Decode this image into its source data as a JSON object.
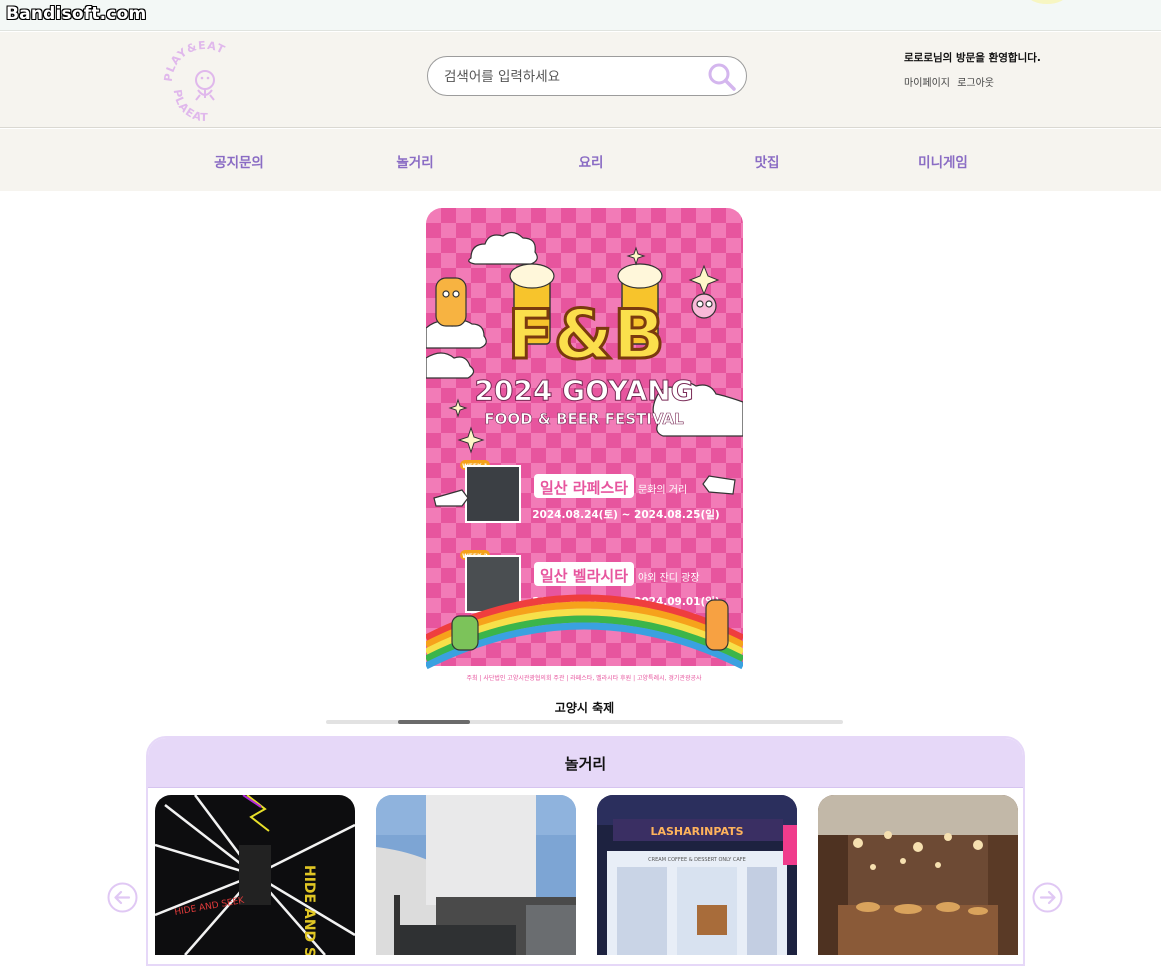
{
  "watermark": {
    "text": "Bandisoft.com"
  },
  "header": {
    "logo_text_top": "PLAY&EAT",
    "logo_text_bottom": "PLAEAT",
    "search": {
      "placeholder": "검색어를 입력하세요",
      "value": ""
    },
    "greeting": "로로로님의 방문을 환영합니다.",
    "links": {
      "mypage": "마이페이지",
      "logout": "로그아웃"
    }
  },
  "nav": {
    "items": [
      {
        "label": "공지문의"
      },
      {
        "label": "놀거리"
      },
      {
        "label": "요리"
      },
      {
        "label": "맛집"
      },
      {
        "label": "미니게임"
      }
    ]
  },
  "banner": {
    "poster": {
      "logo": "F&B",
      "title": "2024 GOYANG",
      "subtitle": "FOOD & BEER FESTIVAL",
      "week1_badge": "WEEK 1",
      "week1_place": "일산 라페스타",
      "week1_place_sub": "문화의 거리",
      "week1_date": "2024.08.24(토) ~ 2024.08.25(일)",
      "week2_badge": "WEEK 2",
      "week2_place": "일산 벨라시타",
      "week2_place_sub": "야외 잔디 광장",
      "week2_date": "2024.08.31(토) ~ 2024.09.01(일)",
      "footer": "주최 | 사단법인 고양시관광협의회    주관 | 라페스타, 벨라시타    후원 | 고양특례시, 경기관광공사"
    },
    "caption": "고양시 축제",
    "slider_progress": 0.14
  },
  "play_section": {
    "title": "놀거리",
    "cards": [
      {
        "sign1": "HIDE AND SEEK",
        "sign2": "HIDE AND SEEK"
      },
      {
        "sign1": ""
      },
      {
        "sign1": "LASHARINPATS",
        "sign2": "CREAM COFFEE & DESSERT ONLY CAFE"
      },
      {
        "sign1": ""
      }
    ]
  },
  "colors": {
    "accent": "#8a6cc4",
    "section_bg": "#e6d8f8",
    "header_bg": "#f6f4ef",
    "poster_pink": "#e2559c"
  }
}
